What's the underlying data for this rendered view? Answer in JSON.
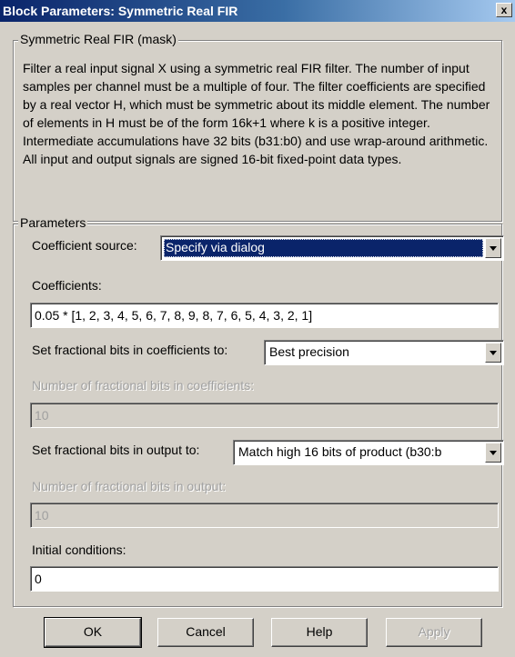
{
  "window": {
    "title": "Block Parameters: Symmetric Real FIR",
    "close_glyph": "x"
  },
  "mask": {
    "legend": "Symmetric Real FIR (mask)",
    "description": "Filter a real input signal X using a symmetric real FIR filter. The number of input samples per channel must be a multiple of four. The filter coefficients are specified by a real vector H, which must be symmetric about its middle element. The number of elements in H must be of the form 16k+1 where k is a positive integer.  Intermediate accumulations have 32 bits (b31:b0) and use wrap-around arithmetic. All input and output signals are signed 16-bit fixed-point data types."
  },
  "params": {
    "legend": "Parameters",
    "coef_source_label": "Coefficient source:",
    "coef_source_value": "Specify via dialog",
    "coefficients_label": "Coefficients:",
    "coefficients_value": "0.05 * [1, 2, 3, 4, 5, 6, 7, 8, 9, 8, 7, 6, 5, 4, 3, 2, 1]",
    "coef_frac_label": "Set fractional bits in coefficients to:",
    "coef_frac_value": "Best precision",
    "num_coef_frac_label": "Number of fractional bits in coefficients:",
    "num_coef_frac_value": "10",
    "out_frac_label": "Set fractional bits in output to:",
    "out_frac_value": "Match high 16 bits of product (b30:b",
    "num_out_frac_label": "Number of fractional bits in output:",
    "num_out_frac_value": "10",
    "init_cond_label": "Initial conditions:",
    "init_cond_value": "0"
  },
  "buttons": {
    "ok": "OK",
    "cancel": "Cancel",
    "help": "Help",
    "apply": "Apply"
  }
}
